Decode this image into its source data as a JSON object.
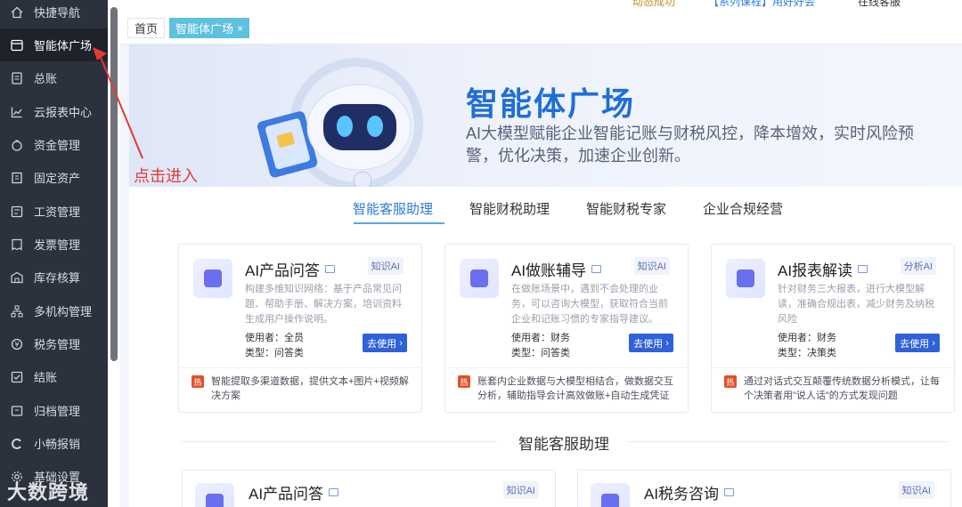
{
  "topbar": {
    "items": [
      "动态成功",
      "【系列课程】用好好会",
      "在线客服"
    ]
  },
  "sidebar": {
    "items": [
      {
        "label": "快捷导航",
        "icon": "home-icon"
      },
      {
        "label": "智能体广场",
        "icon": "window-icon",
        "active": true
      },
      {
        "label": "总账",
        "icon": "ledger-icon"
      },
      {
        "label": "云报表中心",
        "icon": "chart-icon"
      },
      {
        "label": "资金管理",
        "icon": "money-bag-icon"
      },
      {
        "label": "固定资产",
        "icon": "building-icon"
      },
      {
        "label": "工资管理",
        "icon": "payroll-icon"
      },
      {
        "label": "发票管理",
        "icon": "invoice-icon"
      },
      {
        "label": "库存核算",
        "icon": "warehouse-icon"
      },
      {
        "label": "多机构管理",
        "icon": "org-tree-icon"
      },
      {
        "label": "税务管理",
        "icon": "tax-icon"
      },
      {
        "label": "结账",
        "icon": "checkout-icon"
      },
      {
        "label": "归档管理",
        "icon": "archive-icon"
      },
      {
        "label": "小畅报销",
        "icon": "reimburse-icon"
      },
      {
        "label": "基础设置",
        "icon": "gear-icon"
      }
    ]
  },
  "tabs": {
    "home": "首页",
    "current": "智能体广场",
    "close": "×"
  },
  "banner": {
    "title": "智能体广场",
    "desc": "AI大模型赋能企业智能记账与财税风控，降本增效，实时风险预警，优化决策，加速企业创新。"
  },
  "subtabs": [
    "智能客服助理",
    "智能财税助理",
    "智能财税专家",
    "企业合规经营"
  ],
  "cards": [
    {
      "title": "AI产品问答",
      "tag": "知识AI",
      "desc": "构建多维知识网络：基于产品常见问题、帮助手册、解决方案，培训资料生成用户操作说明。",
      "user": "使用者：全员",
      "type": "类型：问答类",
      "go": "去使用",
      "hot": "热",
      "hotdesc": "智能提取多渠道数据，提供文本+图片+视频解决方案"
    },
    {
      "title": "AI做账辅导",
      "tag": "知识AI",
      "desc": "在做账场景中，遇到不会处理的业务，可以咨询大模型，获取符合当前企业和记账习惯的专家指导建议。",
      "user": "使用者：财务",
      "type": "类型：问答类",
      "go": "去使用",
      "hot": "热",
      "hotdesc": "账套内企业数据与大模型相结合，做数据交互分析，辅助指导会计高效做账+自动生成凭证"
    },
    {
      "title": "AI报表解读",
      "tag": "分析AI",
      "desc": "针对财务三大报表，进行大模型解读，准确合规出表，减少财务及纳税风险",
      "user": "使用者：财务",
      "type": "类型：决策类",
      "go": "去使用",
      "hot": "热",
      "hotdesc": "通过对话式交互颠覆传统数据分析模式，让每个决策者用\"说人话\"的方式发现问题"
    }
  ],
  "section": {
    "title": "智能客服助理"
  },
  "cards2": [
    {
      "title": "AI产品问答",
      "tag": "知识AI"
    },
    {
      "title": "AI税务咨询",
      "tag": "知识AI"
    }
  ],
  "annotation": "点击进入",
  "watermark": "大数跨境",
  "colors": {
    "accent": "#2f62d8",
    "tab": "#5ec1e0",
    "sidebar": "#2b313d",
    "annotation": "#e53935"
  }
}
